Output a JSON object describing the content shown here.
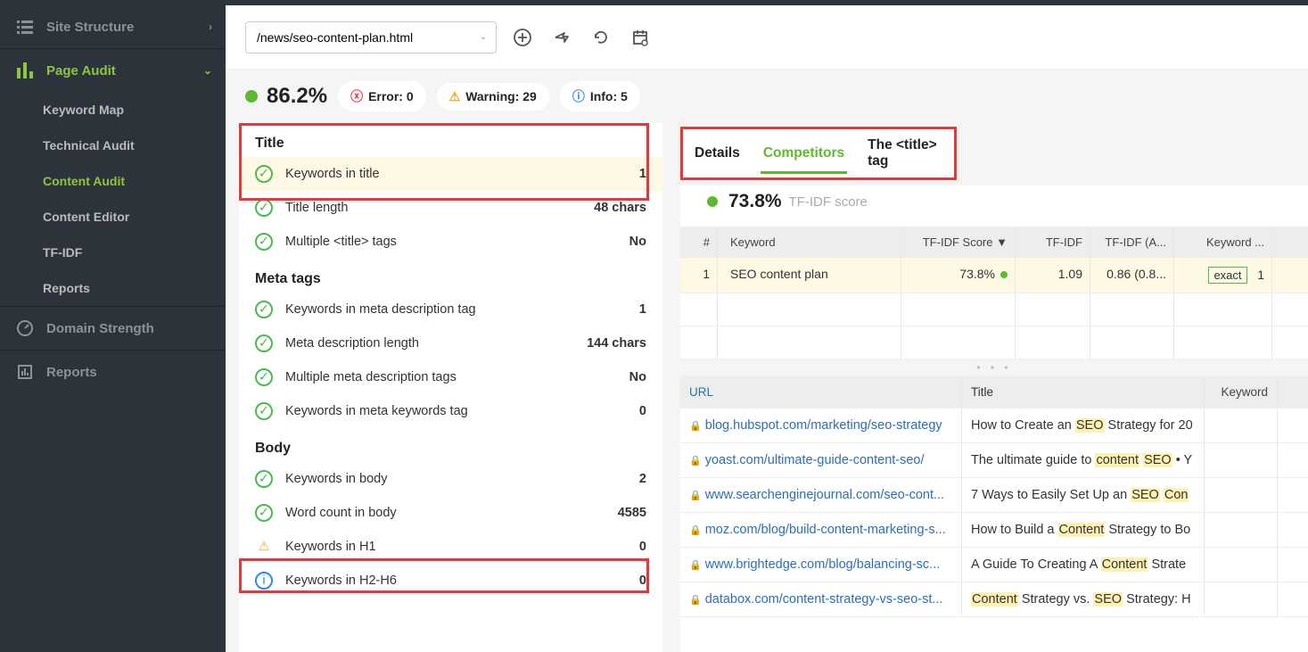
{
  "sidebar": {
    "site_structure": "Site Structure",
    "page_audit": "Page Audit",
    "sub": {
      "keyword_map": "Keyword Map",
      "technical_audit": "Technical Audit",
      "content_audit": "Content Audit",
      "content_editor": "Content Editor",
      "tfidf": "TF-IDF",
      "reports": "Reports"
    },
    "domain_strength": "Domain Strength",
    "reports2": "Reports"
  },
  "url_selector": "/news/seo-content-plan.html",
  "stats": {
    "percent": "86.2%",
    "error_label": "Error: 0",
    "warning_label": "Warning: 29",
    "info_label": "Info: 5"
  },
  "sections": {
    "title": "Title",
    "meta": "Meta tags",
    "body": "Body"
  },
  "checks": {
    "kw_title": {
      "label": "Keywords in title",
      "val": "1"
    },
    "title_len": {
      "label": "Title length",
      "val": "48 chars"
    },
    "multi_title": {
      "label": "Multiple <title> tags",
      "val": "No"
    },
    "kw_meta": {
      "label": "Keywords in meta description tag",
      "val": "1"
    },
    "meta_len": {
      "label": "Meta description length",
      "val": "144 chars"
    },
    "multi_meta": {
      "label": "Multiple meta description tags",
      "val": "No"
    },
    "kw_metakw": {
      "label": "Keywords in meta keywords tag",
      "val": "0"
    },
    "kw_body": {
      "label": "Keywords in body",
      "val": "2"
    },
    "wc_body": {
      "label": "Word count in body",
      "val": "4585"
    },
    "kw_h1": {
      "label": "Keywords in H1",
      "val": "0"
    },
    "kw_h26": {
      "label": "Keywords in H2-H6",
      "val": "0"
    }
  },
  "tabs": {
    "details": "Details",
    "competitors": "Competitors",
    "title_tag": "The <title> tag"
  },
  "tfidf_score": {
    "pct": "73.8%",
    "label": "TF-IDF score"
  },
  "kw_table": {
    "head": {
      "num": "#",
      "kw": "Keyword",
      "score": "TF-IDF Score",
      "tf": "TF-IDF",
      "tfa": "TF-IDF (A...",
      "kwm": "Keyword ..."
    },
    "row1": {
      "num": "1",
      "kw": "SEO content plan",
      "score": "73.8%",
      "tf": "1.09",
      "tfa": "0.86 (0.8...",
      "match": "exact",
      "n": "1"
    }
  },
  "url_table": {
    "head": {
      "url": "URL",
      "title": "Title",
      "kw": "Keyword"
    },
    "rows": [
      {
        "url": "blog.hubspot.com/marketing/seo-strategy",
        "title_a": "How to Create an ",
        "hl": "SEO",
        "title_b": " Strategy for 20"
      },
      {
        "url": "yoast.com/ultimate-guide-content-seo/",
        "title_a": "The ultimate guide to ",
        "hl": "content",
        "mid": " ",
        "hl2": "SEO",
        "title_b": " • Y"
      },
      {
        "url": "www.searchenginejournal.com/seo-cont...",
        "title_a": "7 Ways to Easily Set Up an ",
        "hl": "SEO",
        "mid": " ",
        "hl2": "Con",
        "title_b": ""
      },
      {
        "url": "moz.com/blog/build-content-marketing-s...",
        "title_a": "How to Build a ",
        "hl": "Content",
        "title_b": " Strategy to Bo"
      },
      {
        "url": "www.brightedge.com/blog/balancing-sc...",
        "title_a": "A Guide To Creating A ",
        "hl": "Content",
        "title_b": " Strate"
      },
      {
        "url": "databox.com/content-strategy-vs-seo-st...",
        "hl0": "Content",
        "mid0": " Strategy vs. ",
        "hl": "SEO",
        "title_b": " Strategy: H"
      }
    ]
  }
}
